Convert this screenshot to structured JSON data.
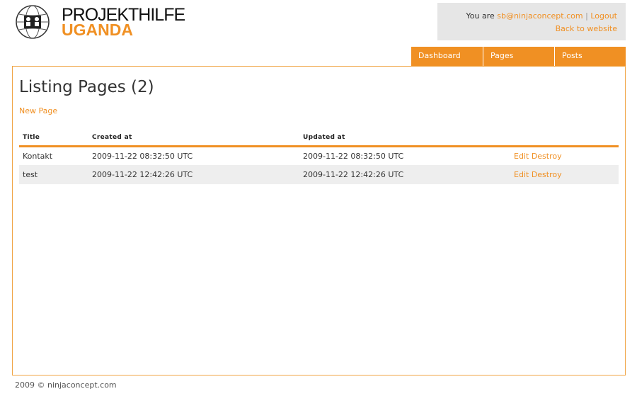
{
  "logo": {
    "line1": "PROJEKTHILFE",
    "line2": "UGANDA",
    "icon": "globe-logo-icon"
  },
  "user": {
    "prefix": "You are",
    "email": "sb@ninjaconcept.com",
    "separator": "|",
    "logout": "Logout",
    "back": "Back to website"
  },
  "nav": {
    "tabs": [
      "Dashboard",
      "Pages",
      "Posts"
    ]
  },
  "main": {
    "title": "Listing Pages (2)",
    "new_link": "New Page",
    "columns": [
      "Title",
      "Created at",
      "Updated at"
    ],
    "rows": [
      {
        "title": "Kontakt",
        "created": "2009-11-22 08:32:50 UTC",
        "updated": "2009-11-22 08:32:50 UTC",
        "edit": "Edit",
        "destroy": "Destroy"
      },
      {
        "title": "test",
        "created": "2009-11-22 12:42:26 UTC",
        "updated": "2009-11-22 12:42:26 UTC",
        "edit": "Edit",
        "destroy": "Destroy"
      }
    ]
  },
  "footer": {
    "text": "2009   © ninjaconcept.com"
  },
  "colors": {
    "accent": "#f09023",
    "user_box_bg": "#e6e6e6",
    "row_alt_bg": "#eeeeee"
  }
}
